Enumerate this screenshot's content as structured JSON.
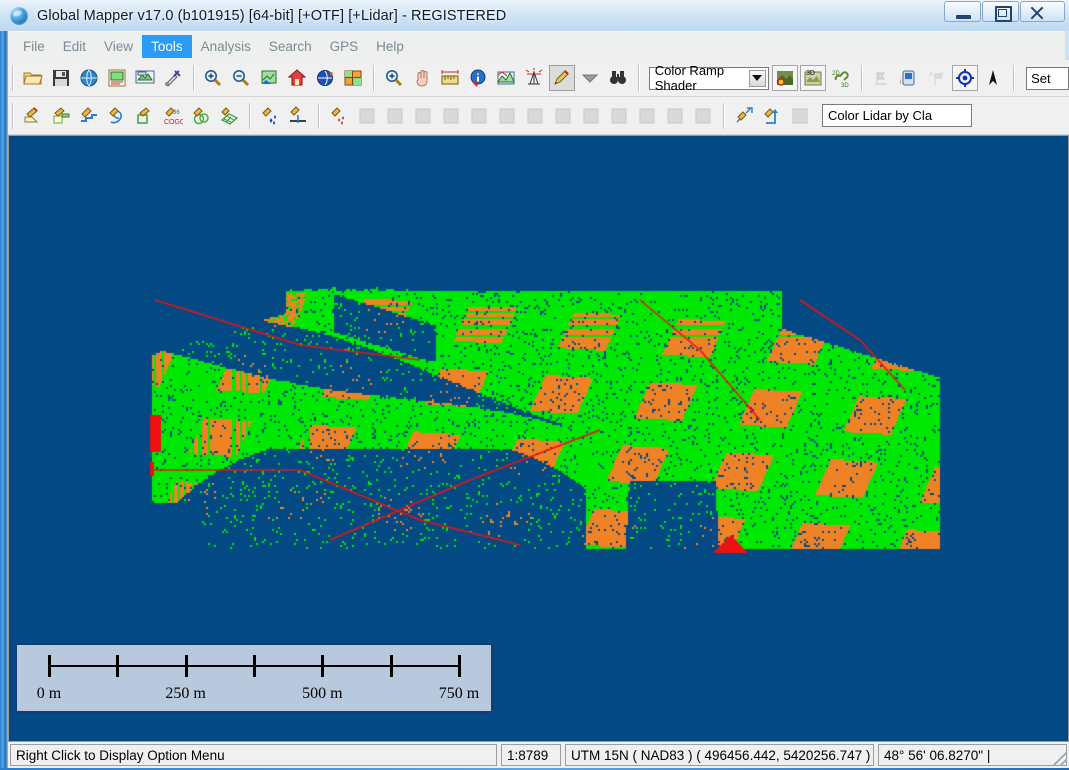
{
  "window": {
    "title": "Global Mapper v17.0 (b101915) [64-bit] [+OTF] [+Lidar] - REGISTERED",
    "app_icon": "globe-icon",
    "minimize_label": "",
    "restore_label": "",
    "close_label": ""
  },
  "menu": {
    "items": [
      {
        "label": "File",
        "active": false
      },
      {
        "label": "Edit",
        "active": false
      },
      {
        "label": "View",
        "active": false
      },
      {
        "label": "Tools",
        "active": true
      },
      {
        "label": "Analysis",
        "active": false
      },
      {
        "label": "Search",
        "active": false
      },
      {
        "label": "GPS",
        "active": false
      },
      {
        "label": "Help",
        "active": false
      }
    ]
  },
  "toolbar_file": {
    "buttons": [
      {
        "icon": "open-folder-icon",
        "label": "Open Data File"
      },
      {
        "icon": "save-floppy-icon",
        "label": "Save Workspace"
      },
      {
        "icon": "globe-online-icon",
        "label": "Connect to Online Data"
      },
      {
        "icon": "overlay-control-icon",
        "label": "Open Control Center"
      },
      {
        "icon": "layer-config-icon",
        "label": "Configure"
      },
      {
        "icon": "tools-icon",
        "label": "Options"
      }
    ]
  },
  "toolbar_view": {
    "buttons": [
      {
        "icon": "zoom-in-icon",
        "label": "Zoom In"
      },
      {
        "icon": "zoom-out-icon",
        "label": "Zoom Out"
      },
      {
        "icon": "zoom-to-layer-icon",
        "label": "Zoom to Selected Layer"
      },
      {
        "icon": "home-icon",
        "label": "Full View"
      },
      {
        "icon": "globe-rotate-icon",
        "label": "3D View"
      },
      {
        "icon": "grid-view-icon",
        "label": "Map Layout"
      }
    ]
  },
  "toolbar_tools": {
    "buttons": [
      {
        "icon": "zoom-tool-icon",
        "label": "Zoom Tool",
        "state": "normal"
      },
      {
        "icon": "pan-hand-icon",
        "label": "Pan Tool",
        "state": "normal"
      },
      {
        "icon": "measure-ruler-icon",
        "label": "Measure Tool",
        "state": "normal"
      },
      {
        "icon": "feature-info-icon",
        "label": "Feature Info Tool",
        "state": "normal"
      },
      {
        "icon": "path-profile-icon",
        "label": "Path Profile",
        "state": "normal"
      },
      {
        "icon": "viewshed-icon",
        "label": "View Shed",
        "state": "normal"
      },
      {
        "icon": "digitizer-pencil-icon",
        "label": "Digitizer Tool",
        "state": "pressed"
      },
      {
        "icon": "chevron-down-icon",
        "label": "More Tools",
        "state": "normal"
      },
      {
        "icon": "binoculars-icon",
        "label": "Find",
        "state": "normal"
      }
    ]
  },
  "shader": {
    "label": "Color Ramp Shader",
    "options": [
      "Color Ramp Shader"
    ]
  },
  "toolbar_shade": {
    "buttons": [
      {
        "icon": "shader-sun-icon",
        "label": "Enable Hill Shading",
        "state": "framed"
      },
      {
        "icon": "view-3d-icon",
        "label": "Show 3D View",
        "state": "framed"
      },
      {
        "icon": "link-2d3d-icon",
        "label": "Link 2D and 3D Views",
        "state": "normal"
      }
    ]
  },
  "toolbar_gps": {
    "buttons": [
      {
        "icon": "gps-track-icon",
        "label": "Start GPS Tracking",
        "state": "disabled"
      },
      {
        "icon": "gps-device-icon",
        "label": "GPS Device Setup",
        "state": "normal"
      },
      {
        "icon": "gps-marker-icon",
        "label": "Mark Waypoint",
        "state": "disabled"
      },
      {
        "icon": "gps-center-icon",
        "label": "Center on GPS",
        "state": "framed"
      },
      {
        "icon": "north-arrow-icon",
        "label": "North Up",
        "state": "normal"
      }
    ]
  },
  "set_field": {
    "value": "Set"
  },
  "toolbar_digitizer": {
    "group_create": [
      {
        "icon": "digitize-area-icon",
        "label": "Create Area Feature",
        "state": "normal"
      },
      {
        "icon": "digitize-rect-icon",
        "label": "Create Rectangle",
        "state": "normal"
      },
      {
        "icon": "digitize-line-icon",
        "label": "Create Line Feature",
        "state": "normal"
      },
      {
        "icon": "digitize-freehand-icon",
        "label": "Create Freehand Feature",
        "state": "normal"
      },
      {
        "icon": "digitize-square-icon",
        "label": "Create Square Area",
        "state": "normal"
      },
      {
        "icon": "cogo-icon",
        "label": "Create Feature from COGO",
        "state": "normal"
      },
      {
        "icon": "digitize-circle-icon",
        "label": "Create Circle/Ellipse",
        "state": "normal"
      },
      {
        "icon": "digitize-grid-icon",
        "label": "Create Grid of Features",
        "state": "normal"
      }
    ],
    "group_point": [
      {
        "icon": "digitize-points-icon",
        "label": "Create Point Features",
        "state": "normal"
      },
      {
        "icon": "digitize-vertex-icon",
        "label": "Insert Vertex",
        "state": "normal"
      }
    ],
    "group_edit": [
      {
        "icon": "edit-points-icon",
        "label": "Edit Points",
        "state": "normal"
      },
      {
        "icon": "edit-stack-icon",
        "label": "Stack Features",
        "state": "disabled"
      },
      {
        "icon": "edit-merge-icon",
        "label": "Merge Areas",
        "state": "disabled"
      },
      {
        "icon": "edit-split-icon",
        "label": "Split Feature",
        "state": "disabled"
      },
      {
        "icon": "edit-globe-icon",
        "label": "Reproject Feature",
        "state": "disabled"
      },
      {
        "icon": "edit-extract-icon",
        "label": "Extract Feature",
        "state": "disabled"
      },
      {
        "icon": "edit-combine-icon",
        "label": "Combine Areas",
        "state": "disabled"
      },
      {
        "icon": "edit-crop-icon",
        "label": "Crop Areas",
        "state": "disabled"
      },
      {
        "icon": "edit-buffer-icon",
        "label": "Create Buffer",
        "state": "disabled"
      },
      {
        "icon": "edit-attributes-icon",
        "label": "Edit Attributes",
        "state": "disabled"
      },
      {
        "icon": "edit-copy-icon",
        "label": "Copy Features",
        "state": "disabled"
      },
      {
        "icon": "edit-smooth-icon",
        "label": "Smooth Feature",
        "state": "disabled"
      },
      {
        "icon": "edit-simplify-icon",
        "label": "Simplify Feature",
        "state": "disabled"
      },
      {
        "icon": "edit-shape-icon",
        "label": "Reshape Feature",
        "state": "disabled"
      }
    ],
    "group_move": [
      {
        "icon": "move-feature-icon",
        "label": "Move Feature",
        "state": "normal"
      },
      {
        "icon": "extend-line-icon",
        "label": "Extend Line",
        "state": "normal"
      },
      {
        "icon": "undo-edit-icon",
        "label": "Undo Edit",
        "state": "disabled"
      }
    ]
  },
  "lidar_style": {
    "label": "Color Lidar by Cla",
    "options": [
      "Color Lidar by Classification"
    ]
  },
  "map": {
    "background_color": "#034a84",
    "lidar_colors": {
      "vegetation_green": "#00e800",
      "building_orange": "#f08226",
      "high_red": "#ee1111",
      "background_navy": "#034a84"
    },
    "scalebar": {
      "labels": [
        "0 m",
        "250 m",
        "500 m",
        "750 m"
      ],
      "tick_count": 7,
      "unit": "m",
      "max_value": 750
    }
  },
  "statusbar": {
    "message": "Right Click to Display Option Menu",
    "scale": "1:8789",
    "projection": "UTM 15N ( NAD83 ) ( 496456.442, 5420256.747 )",
    "latlon": "48° 56' 06.8270\" |"
  }
}
